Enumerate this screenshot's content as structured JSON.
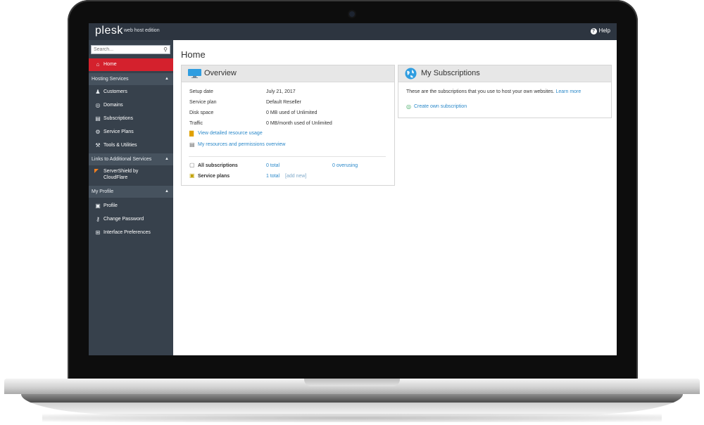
{
  "app": {
    "logo": "plesk",
    "edition": "web host edition",
    "help_label": "Help"
  },
  "search": {
    "placeholder": "Search..."
  },
  "sidebar": {
    "home": "Home",
    "sections": [
      {
        "title": "Hosting Services",
        "items": [
          {
            "label": "Customers",
            "icon": "customer-icon"
          },
          {
            "label": "Domains",
            "icon": "globe-icon"
          },
          {
            "label": "Subscriptions",
            "icon": "subscriptions-icon"
          },
          {
            "label": "Service Plans",
            "icon": "gear-icon"
          },
          {
            "label": "Tools & Utilities",
            "icon": "tools-icon"
          }
        ]
      },
      {
        "title": "Links to Additional Services",
        "items": [
          {
            "label": "ServerShield by\nCloudFlare",
            "icon": "cloudflare-icon"
          }
        ]
      },
      {
        "title": "My Profile",
        "items": [
          {
            "label": "Profile",
            "icon": "profile-icon"
          },
          {
            "label": "Change Password",
            "icon": "key-icon"
          },
          {
            "label": "Interface Preferences",
            "icon": "grid-icon"
          }
        ]
      }
    ]
  },
  "main": {
    "title": "Home",
    "overview": {
      "title": "Overview",
      "rows": [
        {
          "label": "Setup date",
          "value": "July 21, 2017"
        },
        {
          "label": "Service plan",
          "value": "Default Reseller"
        },
        {
          "label": "Disk space",
          "value": "0 MB used of Unlimited"
        },
        {
          "label": "Traffic",
          "value": "0 MB/month used of Unlimited"
        }
      ],
      "links": {
        "resource_usage": "View detailed resource usage",
        "permissions": "My resources and permissions overview"
      },
      "stats": {
        "subscriptions_label": "All subscriptions",
        "subscriptions_total": "0 total",
        "subscriptions_overusing": "0 overusing",
        "plans_label": "Service plans",
        "plans_total": "1 total",
        "plans_add": "[add new]"
      }
    },
    "subscriptions": {
      "title": "My Subscriptions",
      "description": "These are the subscriptions that you use to host your own websites.",
      "learn_more": "Learn more",
      "create": "Create own subscription"
    }
  },
  "colors": {
    "topbar": "#2d3540",
    "sidebar": "#37414c",
    "active": "#d4212d",
    "link": "#2a88c9"
  }
}
